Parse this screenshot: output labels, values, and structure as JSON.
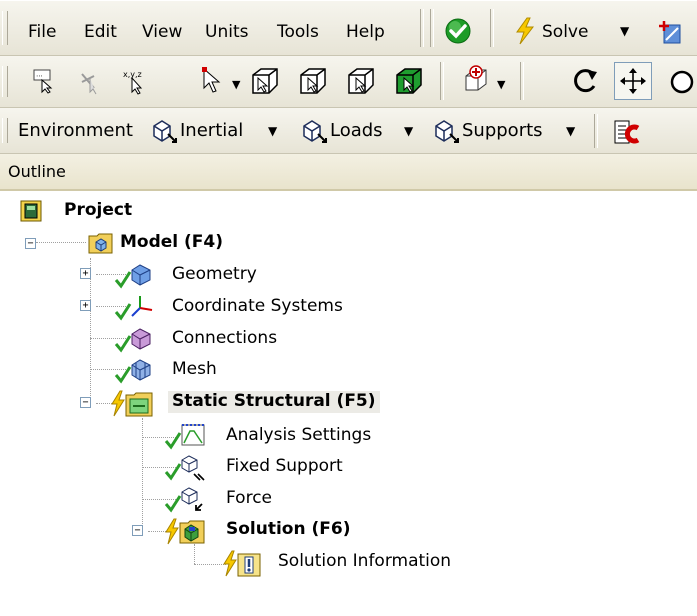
{
  "menu": {
    "file": "File",
    "edit": "Edit",
    "view": "View",
    "units": "Units",
    "tools": "Tools",
    "help": "Help"
  },
  "toolbar1": {
    "solve": "Solve"
  },
  "toolbar3": {
    "environment": "Environment",
    "inertial": "Inertial",
    "loads": "Loads",
    "supports": "Supports"
  },
  "outline": {
    "title": "Outline"
  },
  "tree": {
    "project": "Project",
    "model": "Model (F4)",
    "geometry": "Geometry",
    "coordinate_systems": "Coordinate Systems",
    "connections": "Connections",
    "mesh": "Mesh",
    "static_structural": "Static Structural (F5)",
    "analysis_settings": "Analysis Settings",
    "fixed_support": "Fixed Support",
    "force": "Force",
    "solution": "Solution (F6)",
    "solution_information": "Solution Information"
  },
  "colors": {
    "toolbar_bg": "#ece9d8",
    "check_green": "#00a000",
    "lightning_yellow": "#f5c400",
    "folder_yellow": "#e8c24a"
  }
}
